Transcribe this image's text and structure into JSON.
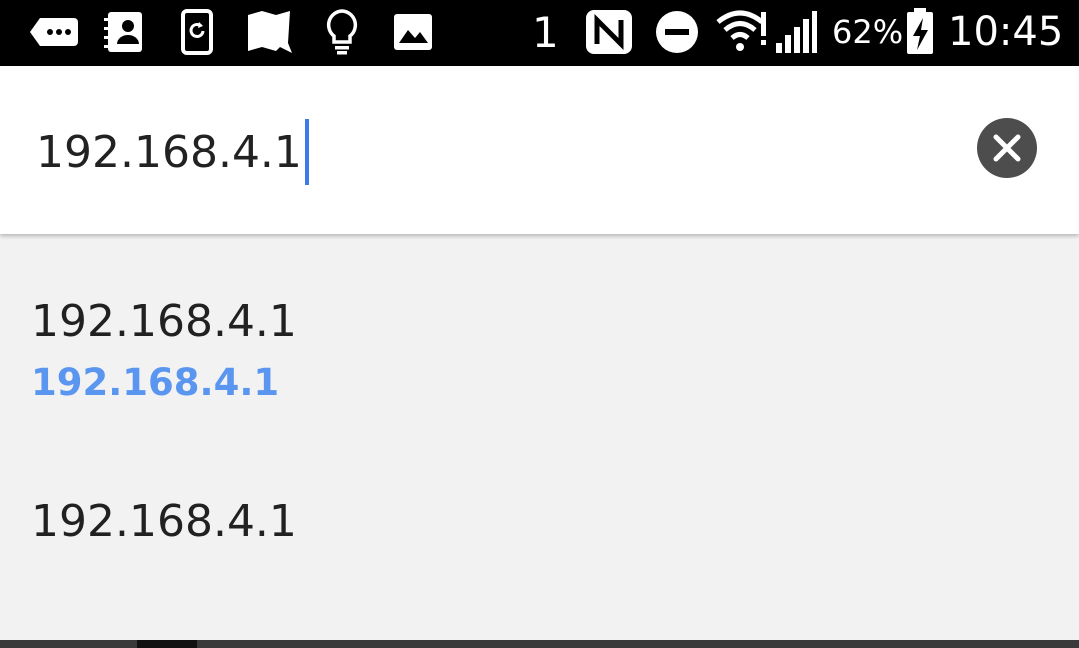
{
  "status_bar": {
    "notification_icons": [
      "messages-icon",
      "contacts-icon",
      "phone-rotate-icon",
      "map-icon",
      "lightbulb-icon",
      "image-icon"
    ],
    "sim_slot": "1",
    "nfc_icon": "nfc-icon",
    "dnd_icon": "do-not-disturb-icon",
    "wifi_icon": "wifi-icon",
    "signal_icon": "signal-icon",
    "battery_percent": "62%",
    "battery_icon": "battery-charging-icon",
    "time": "10:45"
  },
  "url_bar": {
    "value": "192.168.4.1",
    "clear_icon": "clear-icon",
    "caret_color": "#3d7be6"
  },
  "suggestions": [
    {
      "title": "192.168.4.1",
      "url": "192.168.4.1"
    },
    {
      "title": "192.168.4.1"
    }
  ],
  "colors": {
    "accent_link": "#5a96f0",
    "status_bar": "#000000",
    "suggestion_bg": "#f2f2f2"
  }
}
